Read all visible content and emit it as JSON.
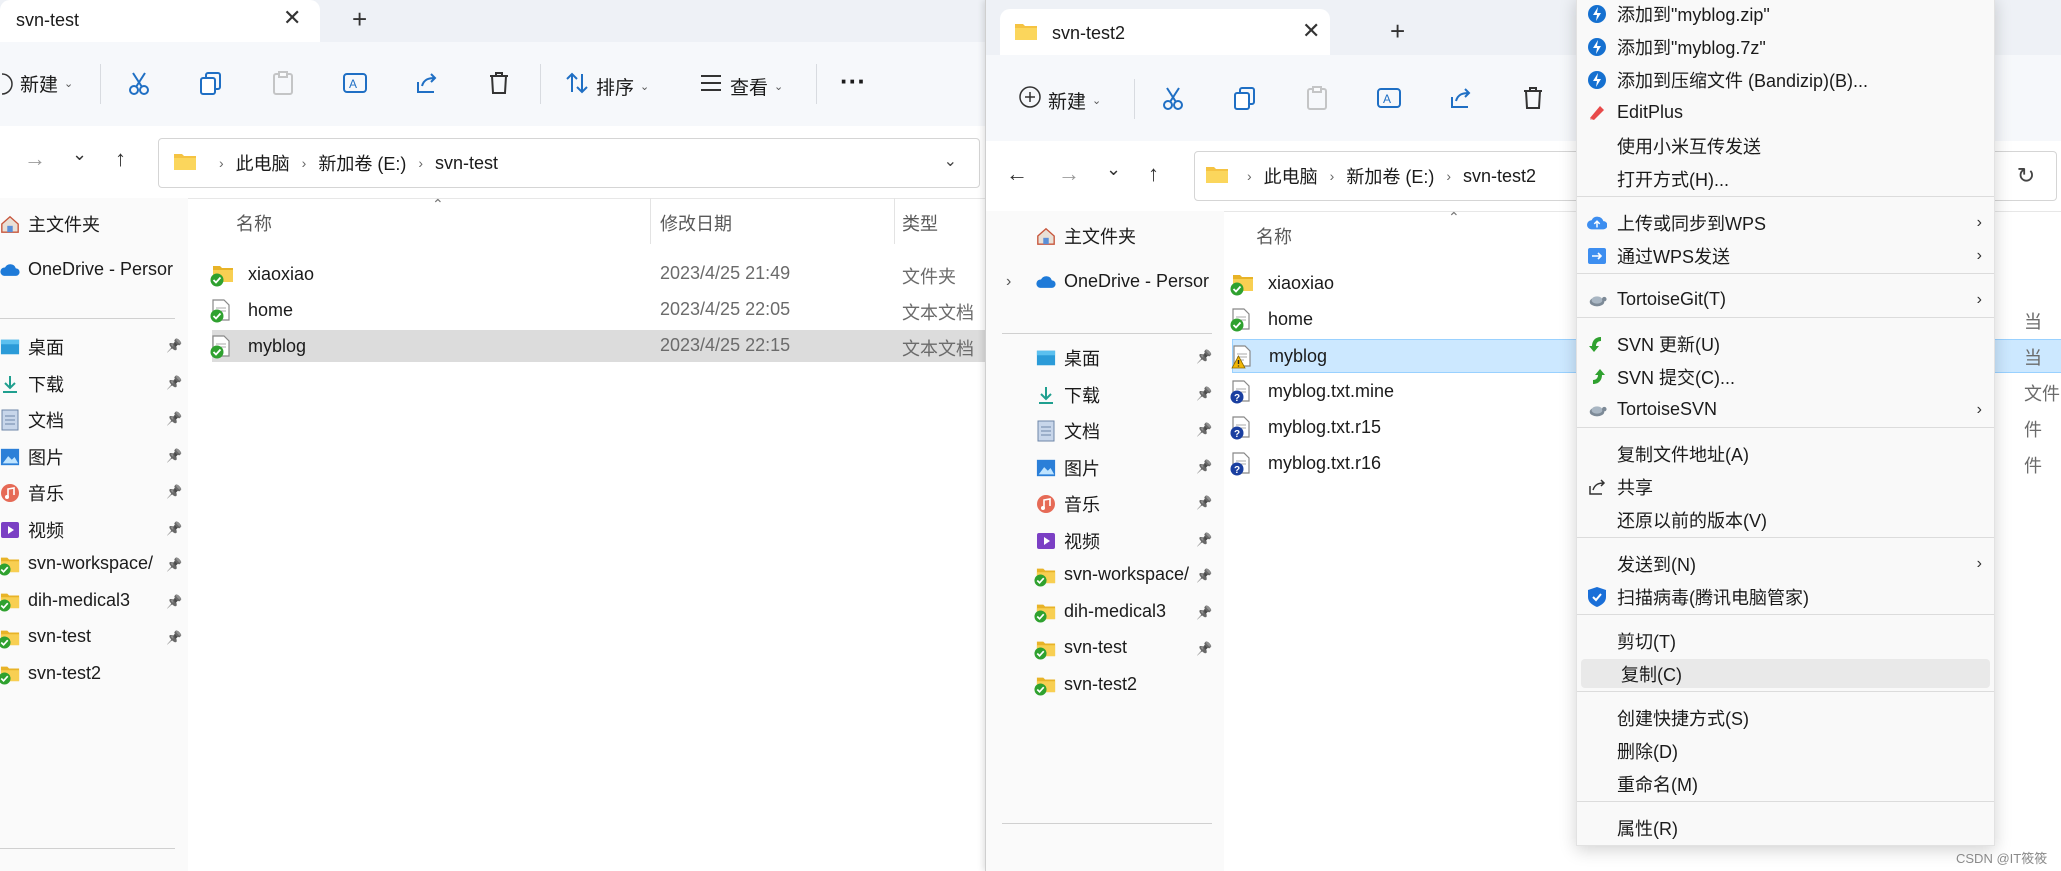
{
  "left_window": {
    "tab_title": "svn-test",
    "toolbar": {
      "new_label": "新建",
      "sort_label": "排序",
      "view_label": "查看",
      "more": "···"
    },
    "breadcrumb": [
      "此电脑",
      "新加卷 (E:)",
      "svn-test"
    ],
    "columns": {
      "name": "名称",
      "date": "修改日期",
      "type": "类型"
    },
    "sidebar": {
      "home": "主文件夹",
      "onedrive": "OneDrive - Persor",
      "pinned": [
        "桌面",
        "下载",
        "文档",
        "图片",
        "音乐",
        "视频",
        "svn-workspace/",
        "dih-medical3",
        "svn-test",
        "svn-test2"
      ]
    },
    "files": [
      {
        "name": "xiaoxiao",
        "date": "2023/4/25 21:49",
        "type": "文件夹"
      },
      {
        "name": "home",
        "date": "2023/4/25 22:05",
        "type": "文本文档"
      },
      {
        "name": "myblog",
        "date": "2023/4/25 22:15",
        "type": "文本文档"
      }
    ]
  },
  "right_window": {
    "tab_title": "svn-test2",
    "toolbar": {
      "new_label": "新建"
    },
    "breadcrumb": [
      "此电脑",
      "新加卷 (E:)",
      "svn-test2"
    ],
    "columns": {
      "name": "名称"
    },
    "sidebar": {
      "home": "主文件夹",
      "onedrive": "OneDrive - Persor",
      "pinned": [
        "桌面",
        "下载",
        "文档",
        "图片",
        "音乐",
        "视频",
        "svn-workspace/",
        "dih-medical3",
        "svn-test",
        "svn-test2"
      ]
    },
    "files": [
      {
        "name": "xiaoxiao"
      },
      {
        "name": "home"
      },
      {
        "name": "myblog"
      },
      {
        "name": "myblog.txt.mine"
      },
      {
        "name": "myblog.txt.r15"
      },
      {
        "name": "myblog.txt.r16"
      }
    ],
    "peek_types": [
      "当",
      "当",
      "文件",
      "件",
      "件"
    ]
  },
  "context_menu": {
    "items": [
      {
        "label": "添加到\"myblog.zip\"",
        "icon": "bandizip-icon"
      },
      {
        "label": "添加到\"myblog.7z\"",
        "icon": "bandizip-icon"
      },
      {
        "label": "添加到压缩文件 (Bandizip)(B)...",
        "icon": "bandizip-icon"
      },
      {
        "label": "EditPlus",
        "icon": "editplus-icon"
      },
      {
        "label": "使用小米互传发送",
        "icon": ""
      },
      {
        "label": "打开方式(H)...",
        "icon": ""
      },
      {
        "label": "上传或同步到WPS",
        "icon": "wps-cloud-icon",
        "submenu": true
      },
      {
        "label": "通过WPS发送",
        "icon": "wps-send-icon",
        "submenu": true
      },
      {
        "label": "TortoiseGit(T)",
        "icon": "tortoise-icon",
        "submenu": true
      },
      {
        "label": "SVN 更新(U)",
        "icon": "svn-update-icon"
      },
      {
        "label": "SVN 提交(C)...",
        "icon": "svn-commit-icon"
      },
      {
        "label": "TortoiseSVN",
        "icon": "tortoise-icon",
        "submenu": true
      },
      {
        "label": "复制文件地址(A)",
        "icon": ""
      },
      {
        "label": "共享",
        "icon": "share-icon"
      },
      {
        "label": "还原以前的版本(V)",
        "icon": ""
      },
      {
        "label": "发送到(N)",
        "icon": "",
        "submenu": true
      },
      {
        "label": "扫描病毒(腾讯电脑管家)",
        "icon": "shield-icon"
      },
      {
        "label": "剪切(T)",
        "icon": ""
      },
      {
        "label": "复制(C)",
        "icon": ""
      },
      {
        "label": "创建快捷方式(S)",
        "icon": ""
      },
      {
        "label": "删除(D)",
        "icon": ""
      },
      {
        "label": "重命名(M)",
        "icon": ""
      },
      {
        "label": "属性(R)",
        "icon": ""
      }
    ]
  },
  "watermark": "CSDN @IT筱筱",
  "colors": {
    "accent": "#0067c0",
    "selection_gray": "#dcdcdc",
    "selection_blue": "#cce8ff",
    "svn_green": "#2fa12f"
  }
}
